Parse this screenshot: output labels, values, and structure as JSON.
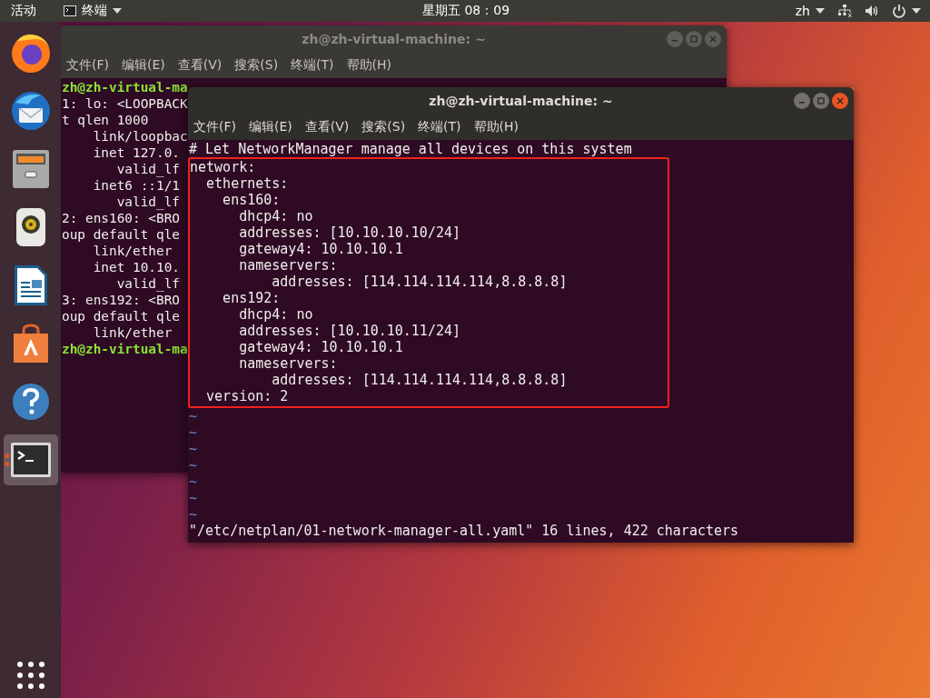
{
  "top_bar": {
    "activities": "活动",
    "app_menu": "终端",
    "clock": "星期五 08：09",
    "input_method": "zh"
  },
  "dock": {
    "items": [
      {
        "kind": "browser",
        "running": false,
        "selected": false
      },
      {
        "kind": "mail",
        "running": false,
        "selected": false
      },
      {
        "kind": "files",
        "running": false,
        "selected": false
      },
      {
        "kind": "music",
        "running": false,
        "selected": false
      },
      {
        "kind": "writer",
        "running": false,
        "selected": false
      },
      {
        "kind": "software",
        "running": false,
        "selected": false
      },
      {
        "kind": "help",
        "running": false,
        "selected": false
      },
      {
        "kind": "terminal",
        "running": true,
        "selected": true
      }
    ]
  },
  "windows": [
    {
      "kind": "shell",
      "title": "zh@zh-virtual-machine: ~",
      "active": false,
      "menu": [
        "文件(F)",
        "编辑(E)",
        "查看(V)",
        "搜索(S)",
        "终端(T)",
        "帮助(H)"
      ],
      "lines": [
        {
          "kind": "prompt",
          "text": "zh@zh-virtual-ma"
        },
        {
          "kind": "output",
          "text": "1: lo: <LOOPBACK"
        },
        {
          "kind": "output",
          "text": "t qlen 1000"
        },
        {
          "kind": "output",
          "text": "    link/loopbac"
        },
        {
          "kind": "output",
          "text": "    inet 127.0."
        },
        {
          "kind": "output",
          "text": "       valid_lf"
        },
        {
          "kind": "output",
          "text": "    inet6 ::1/1"
        },
        {
          "kind": "output",
          "text": "       valid_lf"
        },
        {
          "kind": "output",
          "text": "2: ens160: <BRO"
        },
        {
          "kind": "output",
          "text": "oup default qle"
        },
        {
          "kind": "output",
          "text": "    link/ether"
        },
        {
          "kind": "output",
          "text": "    inet 10.10."
        },
        {
          "kind": "output",
          "text": "       valid_lf"
        },
        {
          "kind": "output",
          "text": "3: ens192: <BRO"
        },
        {
          "kind": "output",
          "text": "oup default qle"
        },
        {
          "kind": "output",
          "text": "    link/ether"
        },
        {
          "kind": "prompt",
          "text": "zh@zh-virtual-ma"
        }
      ]
    },
    {
      "kind": "editor",
      "title": "zh@zh-virtual-machine: ~",
      "active": true,
      "menu": [
        "文件(F)",
        "编辑(E)",
        "查看(V)",
        "搜索(S)",
        "终端(T)",
        "帮助(H)"
      ],
      "comment": "# Let NetworkManager manage all devices on this system",
      "highlighted_lines": [
        "network:",
        "  ethernets:",
        "    ens160:",
        "      dhcp4: no",
        "      addresses: [10.10.10.10/24]",
        "      gateway4: 10.10.10.1",
        "      nameservers:",
        "          addresses: [114.114.114.114,8.8.8.8]",
        "    ens192:",
        "      dhcp4: no",
        "      addresses: [10.10.10.11/24]",
        "      gateway4: 10.10.10.1",
        "      nameservers:",
        "          addresses: [114.114.114.114,8.8.8.8]",
        "  version: 2"
      ],
      "empty_lines": [
        "~",
        "~",
        "~",
        "~",
        "~",
        "~",
        "~"
      ],
      "status": "\"/etc/netplan/01-network-manager-all.yaml\" 16 lines, 422 characters"
    }
  ]
}
